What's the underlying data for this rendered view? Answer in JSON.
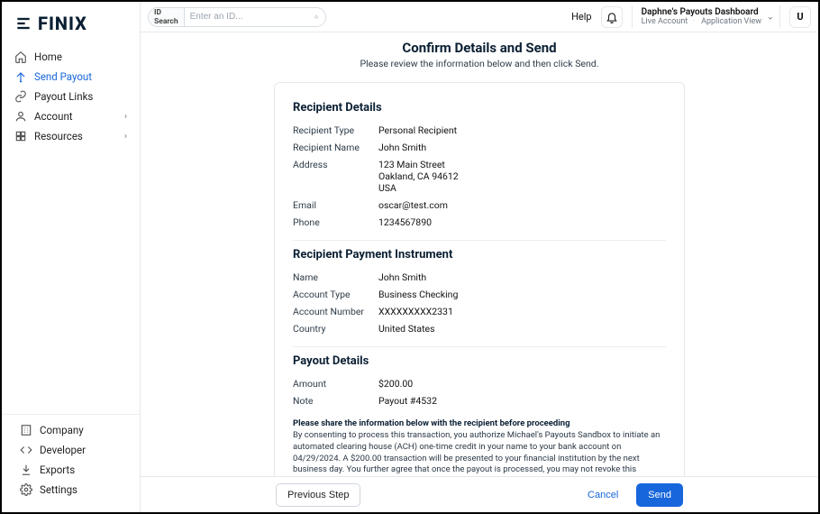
{
  "brand": "FINIX",
  "nav": {
    "top": [
      {
        "label": "Home",
        "icon": "home-icon"
      },
      {
        "label": "Send Payout",
        "icon": "send-icon",
        "active": true
      },
      {
        "label": "Payout Links",
        "icon": "link-icon"
      },
      {
        "label": "Account",
        "icon": "account-icon",
        "chevron": true
      },
      {
        "label": "Resources",
        "icon": "resources-icon",
        "chevron": true
      }
    ],
    "bottom": [
      {
        "label": "Company",
        "icon": "company-icon"
      },
      {
        "label": "Developer",
        "icon": "developer-icon"
      },
      {
        "label": "Exports",
        "icon": "exports-icon"
      },
      {
        "label": "Settings",
        "icon": "settings-icon"
      }
    ]
  },
  "topbar": {
    "search_label": "ID Search",
    "search_placeholder": "Enter an ID...",
    "help": "Help",
    "account_name": "Daphne's Payouts Dashboard",
    "account_mode": "Live Account",
    "account_view": "Application View",
    "avatar_initial": "U"
  },
  "page": {
    "title": "Confirm Details and Send",
    "subtitle": "Please review the information below and then click Send."
  },
  "sections": {
    "recipient_details_title": "Recipient Details",
    "recipient_instrument_title": "Recipient Payment Instrument",
    "payout_details_title": "Payout Details",
    "recipient": {
      "type_label": "Recipient Type",
      "type_value": "Personal Recipient",
      "name_label": "Recipient Name",
      "name_value": "John Smith",
      "address_label": "Address",
      "address_line1": "123 Main Street",
      "address_line2": "Oakland, CA 94612",
      "address_line3": "USA",
      "email_label": "Email",
      "email_value": "oscar@test.com",
      "phone_label": "Phone",
      "phone_value": "1234567890"
    },
    "instrument": {
      "name_label": "Name",
      "name_value": "John Smith",
      "acct_type_label": "Account Type",
      "acct_type_value": "Business Checking",
      "acct_num_label": "Account Number",
      "acct_num_value": "XXXXXXXXX2331",
      "country_label": "Country",
      "country_value": "United States"
    },
    "payout": {
      "amount_label": "Amount",
      "amount_value": "$200.00",
      "note_label": "Note",
      "note_value": "Payout #4532"
    },
    "legal_title": "Please share the information below with the recipient before proceeding",
    "legal_body": "By consenting to process this transaction, you authorize Michael's Payouts Sandbox to initiate an automated clearing house (ACH) one-time credit in your name to your bank account on 04/29/2024. A $200.00 transaction will be presented to your financial institution by the next business day. You further agree that once the payout is processed, you may not revoke this authorization or cancel it. Do I have your authorization to process this payout?"
  },
  "footer": {
    "prev": "Previous Step",
    "cancel": "Cancel",
    "send": "Send"
  }
}
